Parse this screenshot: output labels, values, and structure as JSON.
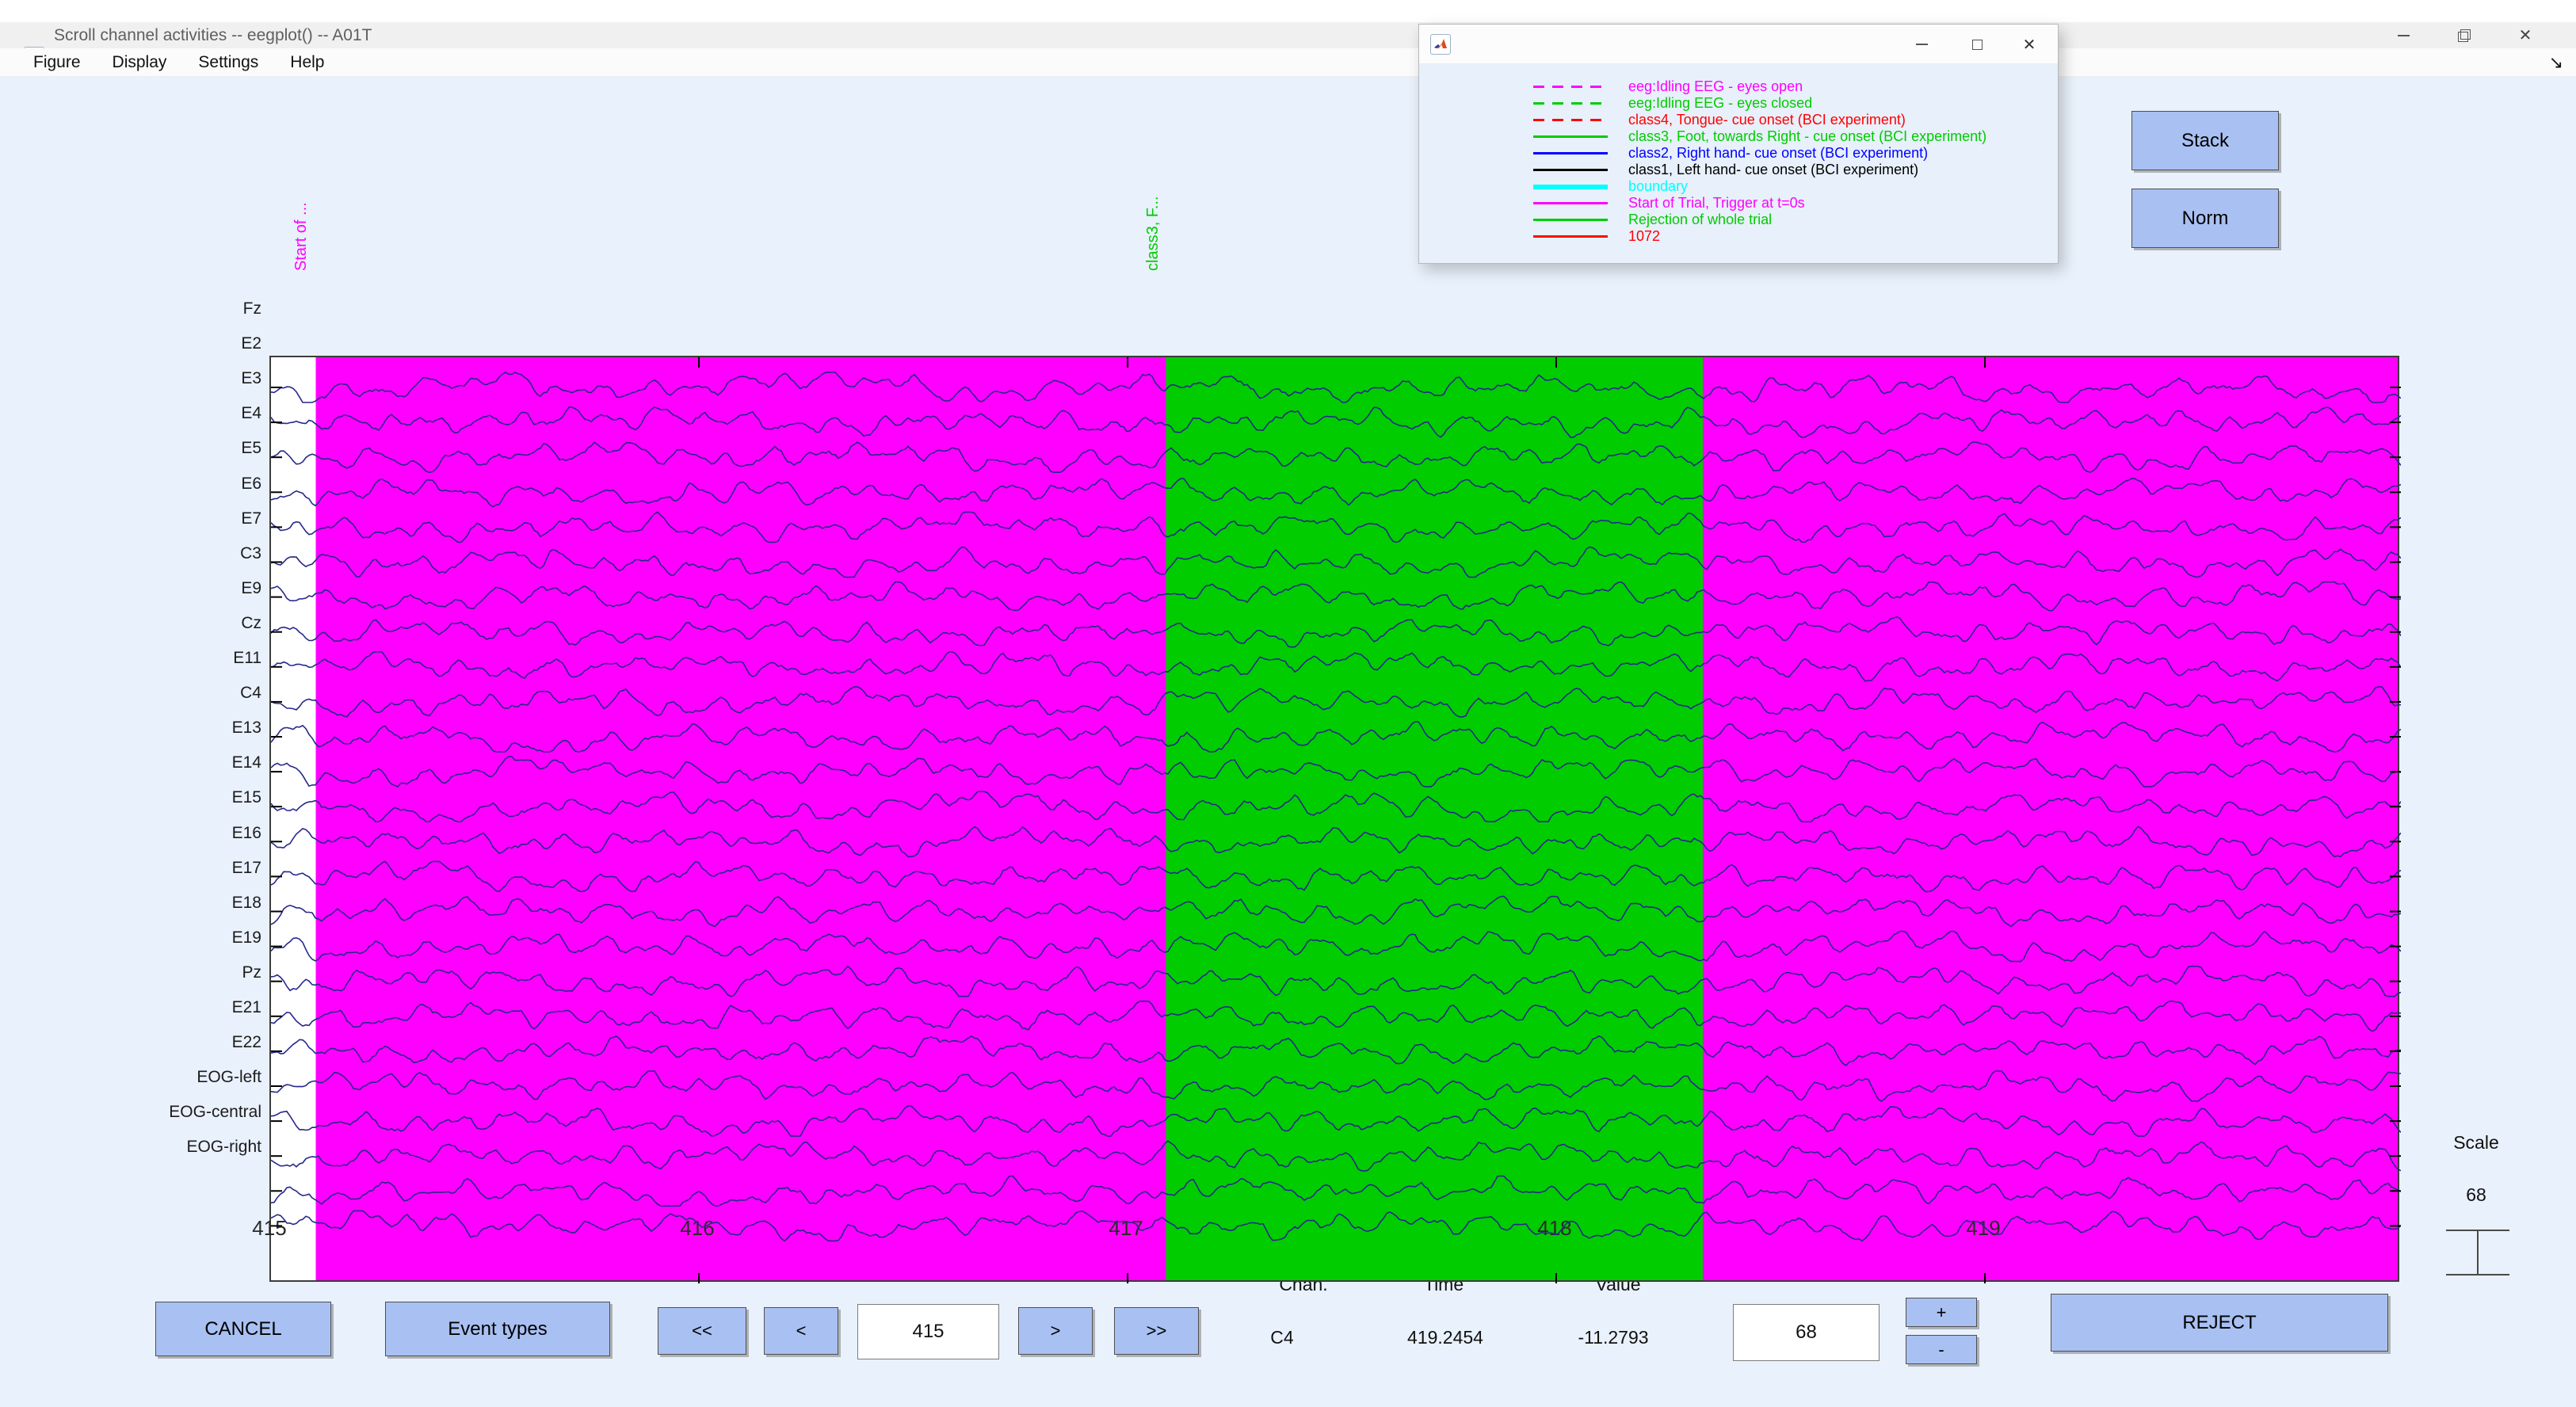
{
  "window": {
    "title": "Scroll channel activities -- eegplot() -- A01T",
    "close_glyph": "✕",
    "toolbar_arrow_glyph": "↘"
  },
  "menu": {
    "items": [
      "Figure",
      "Display",
      "Settings",
      "Help"
    ]
  },
  "legend": {
    "entries": [
      {
        "label": "eeg:Idling EEG - eyes open",
        "color": "#FF00FF",
        "line": "dashed"
      },
      {
        "label": "eeg:Idling EEG - eyes closed",
        "color": "#00CC00",
        "line": "dashed"
      },
      {
        "label": "class4, Tongue- cue onset (BCI experiment)",
        "color": "#FF0000",
        "line": "dashed"
      },
      {
        "label": "class3, Foot, towards Right - cue onset (BCI experiment)",
        "color": "#00CC00",
        "line": "solid"
      },
      {
        "label": "class2, Right hand- cue onset (BCI experiment)",
        "color": "#0000FF",
        "line": "solid"
      },
      {
        "label": "class1, Left hand- cue onset (BCI experiment)",
        "color": "#000000",
        "line": "solid"
      },
      {
        "label": "boundary",
        "color": "#00FFFF",
        "line": "thick"
      },
      {
        "label": "Start of Trial, Trigger at t=0s",
        "color": "#FF00FF",
        "line": "solid"
      },
      {
        "label": "Rejection of whole trial",
        "color": "#00CC00",
        "line": "solid"
      },
      {
        "label": "1072",
        "color": "#FF0000",
        "line": "solid"
      }
    ]
  },
  "plot": {
    "channels": [
      "Fz",
      "E2",
      "E3",
      "E4",
      "E5",
      "E6",
      "E7",
      "C3",
      "E9",
      "Cz",
      "E11",
      "C4",
      "E13",
      "E14",
      "E15",
      "E16",
      "E17",
      "E18",
      "E19",
      "Pz",
      "E21",
      "E22",
      "EOG-left",
      "EOG-central",
      "EOG-right"
    ],
    "xticks": [
      {
        "label": "415",
        "pct": 0
      },
      {
        "label": "416",
        "pct": 20.09
      },
      {
        "label": "417",
        "pct": 40.22
      },
      {
        "label": "418",
        "pct": 60.34
      },
      {
        "label": "419",
        "pct": 80.47
      }
    ],
    "regions": [
      {
        "from_pct": 0,
        "to_pct": 2.16,
        "color": "#FFFFFF"
      },
      {
        "from_pct": 2.16,
        "to_pct": 42.15,
        "color": "#FF00FF"
      },
      {
        "from_pct": 42.15,
        "to_pct": 67.34,
        "color": "#00CC00"
      },
      {
        "from_pct": 67.34,
        "to_pct": 100,
        "color": "#FF00FF"
      }
    ],
    "event_markers": [
      {
        "label": "Start of ...",
        "color": "#FF00FF",
        "pct": 2.16
      },
      {
        "label": "class3, F...",
        "color": "#00CC00",
        "pct": 42.15
      }
    ],
    "trace_color": "#28288c"
  },
  "stack_button": "Stack",
  "norm_button": "Norm",
  "scale": {
    "label": "Scale",
    "value": "68"
  },
  "controls": {
    "cancel": "CANCEL",
    "event_types": "Event types",
    "nav": {
      "fast_back": "<<",
      "back": "<",
      "forward": ">",
      "fast_forward": ">>"
    },
    "position_value": "415",
    "readout": {
      "chan_header": "Chan.",
      "time_header": "Time",
      "value_header": "Value",
      "chan": "C4",
      "time": "419.2454",
      "value": "-11.2793"
    },
    "scale_edit": "68",
    "plus": "+",
    "minus": "-",
    "reject": "REJECT"
  },
  "colors": {
    "figure_bg": "#e9f1fc",
    "button": "#a9c0f2",
    "titlebar": "#f0f0f0"
  }
}
